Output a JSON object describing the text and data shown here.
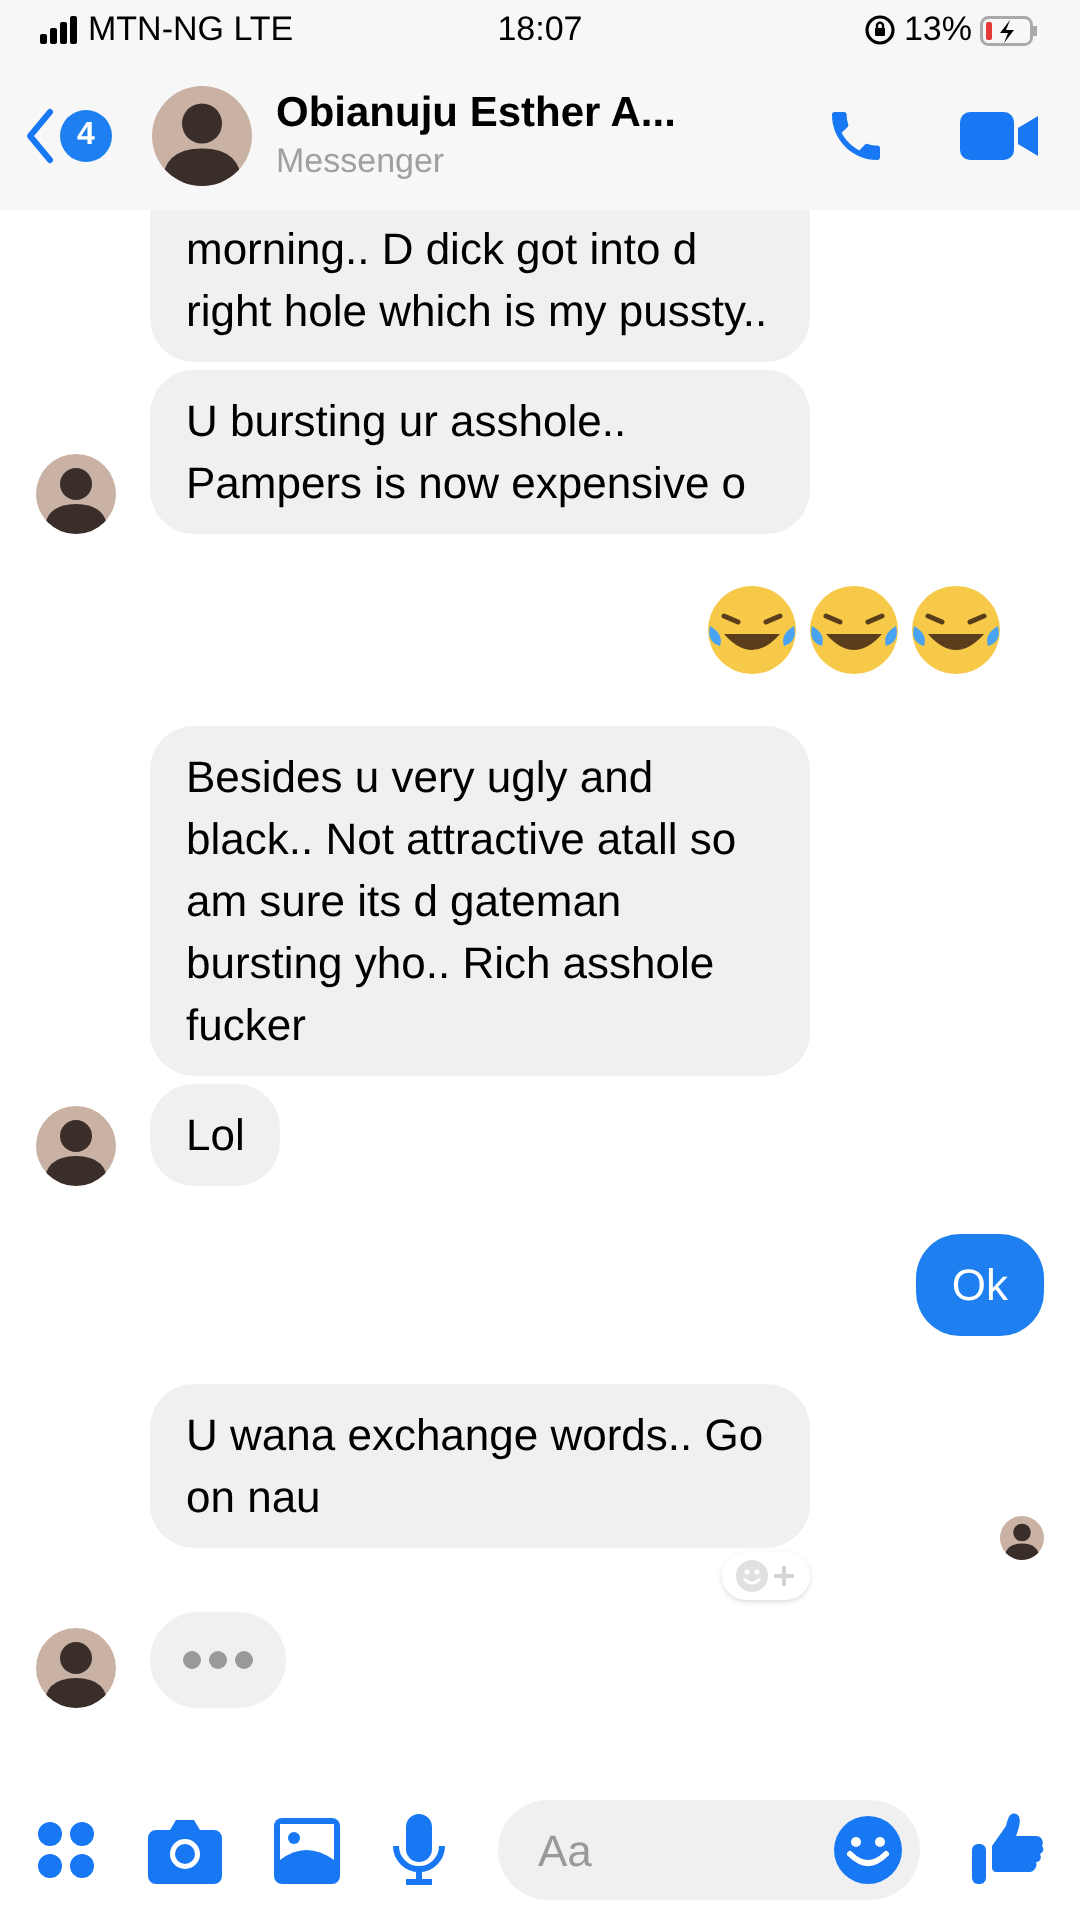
{
  "status_bar": {
    "carrier": "MTN-NG LTE",
    "time": "18:07",
    "battery": "13%"
  },
  "header": {
    "back_count": "4",
    "name": "Obianuju Esther A...",
    "subtitle": "Messenger"
  },
  "messages": [
    {
      "kind": "incoming",
      "avatar": false,
      "cut_top": true,
      "text": "morning.. D dick got into d right hole which is my pussty.."
    },
    {
      "kind": "incoming",
      "avatar": true,
      "text": "U bursting ur asshole.. Pampers is now expensive o"
    },
    {
      "kind": "laughing_emojis"
    },
    {
      "kind": "incoming",
      "avatar": false,
      "text": "Besides u very ugly and black.. Not attractive atall so am sure its d gateman bursting yho.. Rich asshole fucker"
    },
    {
      "kind": "incoming",
      "avatar": true,
      "text": "Lol"
    },
    {
      "kind": "outgoing",
      "text": "Ok"
    },
    {
      "kind": "incoming",
      "avatar": false,
      "seen": true,
      "text": "U wana exchange words.. Go on nau"
    },
    {
      "kind": "typing",
      "avatar": true
    }
  ],
  "composer": {
    "placeholder": "Aa"
  }
}
